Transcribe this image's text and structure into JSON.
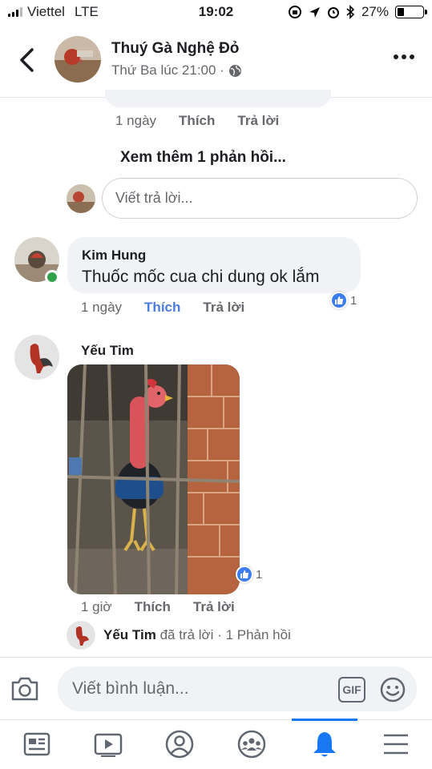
{
  "status_bar": {
    "carrier": "Viettel",
    "network": "LTE",
    "time": "19:02",
    "battery": "27%",
    "battery_level": 0.27
  },
  "header": {
    "title": "Thuý Gà Nghệ Đỏ",
    "subtitle": "Thứ Ba lúc 21:00 ·",
    "privacy_icon": "globe-icon"
  },
  "top_comment": {
    "time": "1 ngày",
    "like_label": "Thích",
    "reply_label": "Trả lời"
  },
  "see_more_replies": "Xem thêm 1 phản hồi...",
  "reply_input": {
    "placeholder": "Viết trả lời..."
  },
  "comments": [
    {
      "author": "Kim Hung",
      "text": "Thuốc mốc cua chi dung ok lắm",
      "time": "1 ngày",
      "like_label": "Thích",
      "reply_label": "Trả lời",
      "reaction_count": "1",
      "online": true
    },
    {
      "author": "Yếu Tim",
      "text": "",
      "time": "1 giờ",
      "like_label": "Thích",
      "reply_label": "Trả lời",
      "reaction_count": "1",
      "has_photo": true
    }
  ],
  "replied_summary": {
    "name": "Yếu Tim",
    "action": "đã trả lời ·",
    "count": "1 Phản hồi"
  },
  "composer": {
    "placeholder": "Viết bình luận...",
    "gif_label": "GIF"
  },
  "tabs": [
    {
      "name": "news-feed",
      "icon": "feed-icon"
    },
    {
      "name": "watch",
      "icon": "video-icon"
    },
    {
      "name": "profile",
      "icon": "profile-icon"
    },
    {
      "name": "groups",
      "icon": "groups-icon"
    },
    {
      "name": "notifications",
      "icon": "bell-icon",
      "active": true
    },
    {
      "name": "menu",
      "icon": "menu-icon"
    }
  ],
  "colors": {
    "accent": "#1877f2",
    "like_blue": "#3b7cf0",
    "bubble": "#f0f2f5",
    "secondary_text": "#65676b",
    "online": "#31a24c"
  }
}
